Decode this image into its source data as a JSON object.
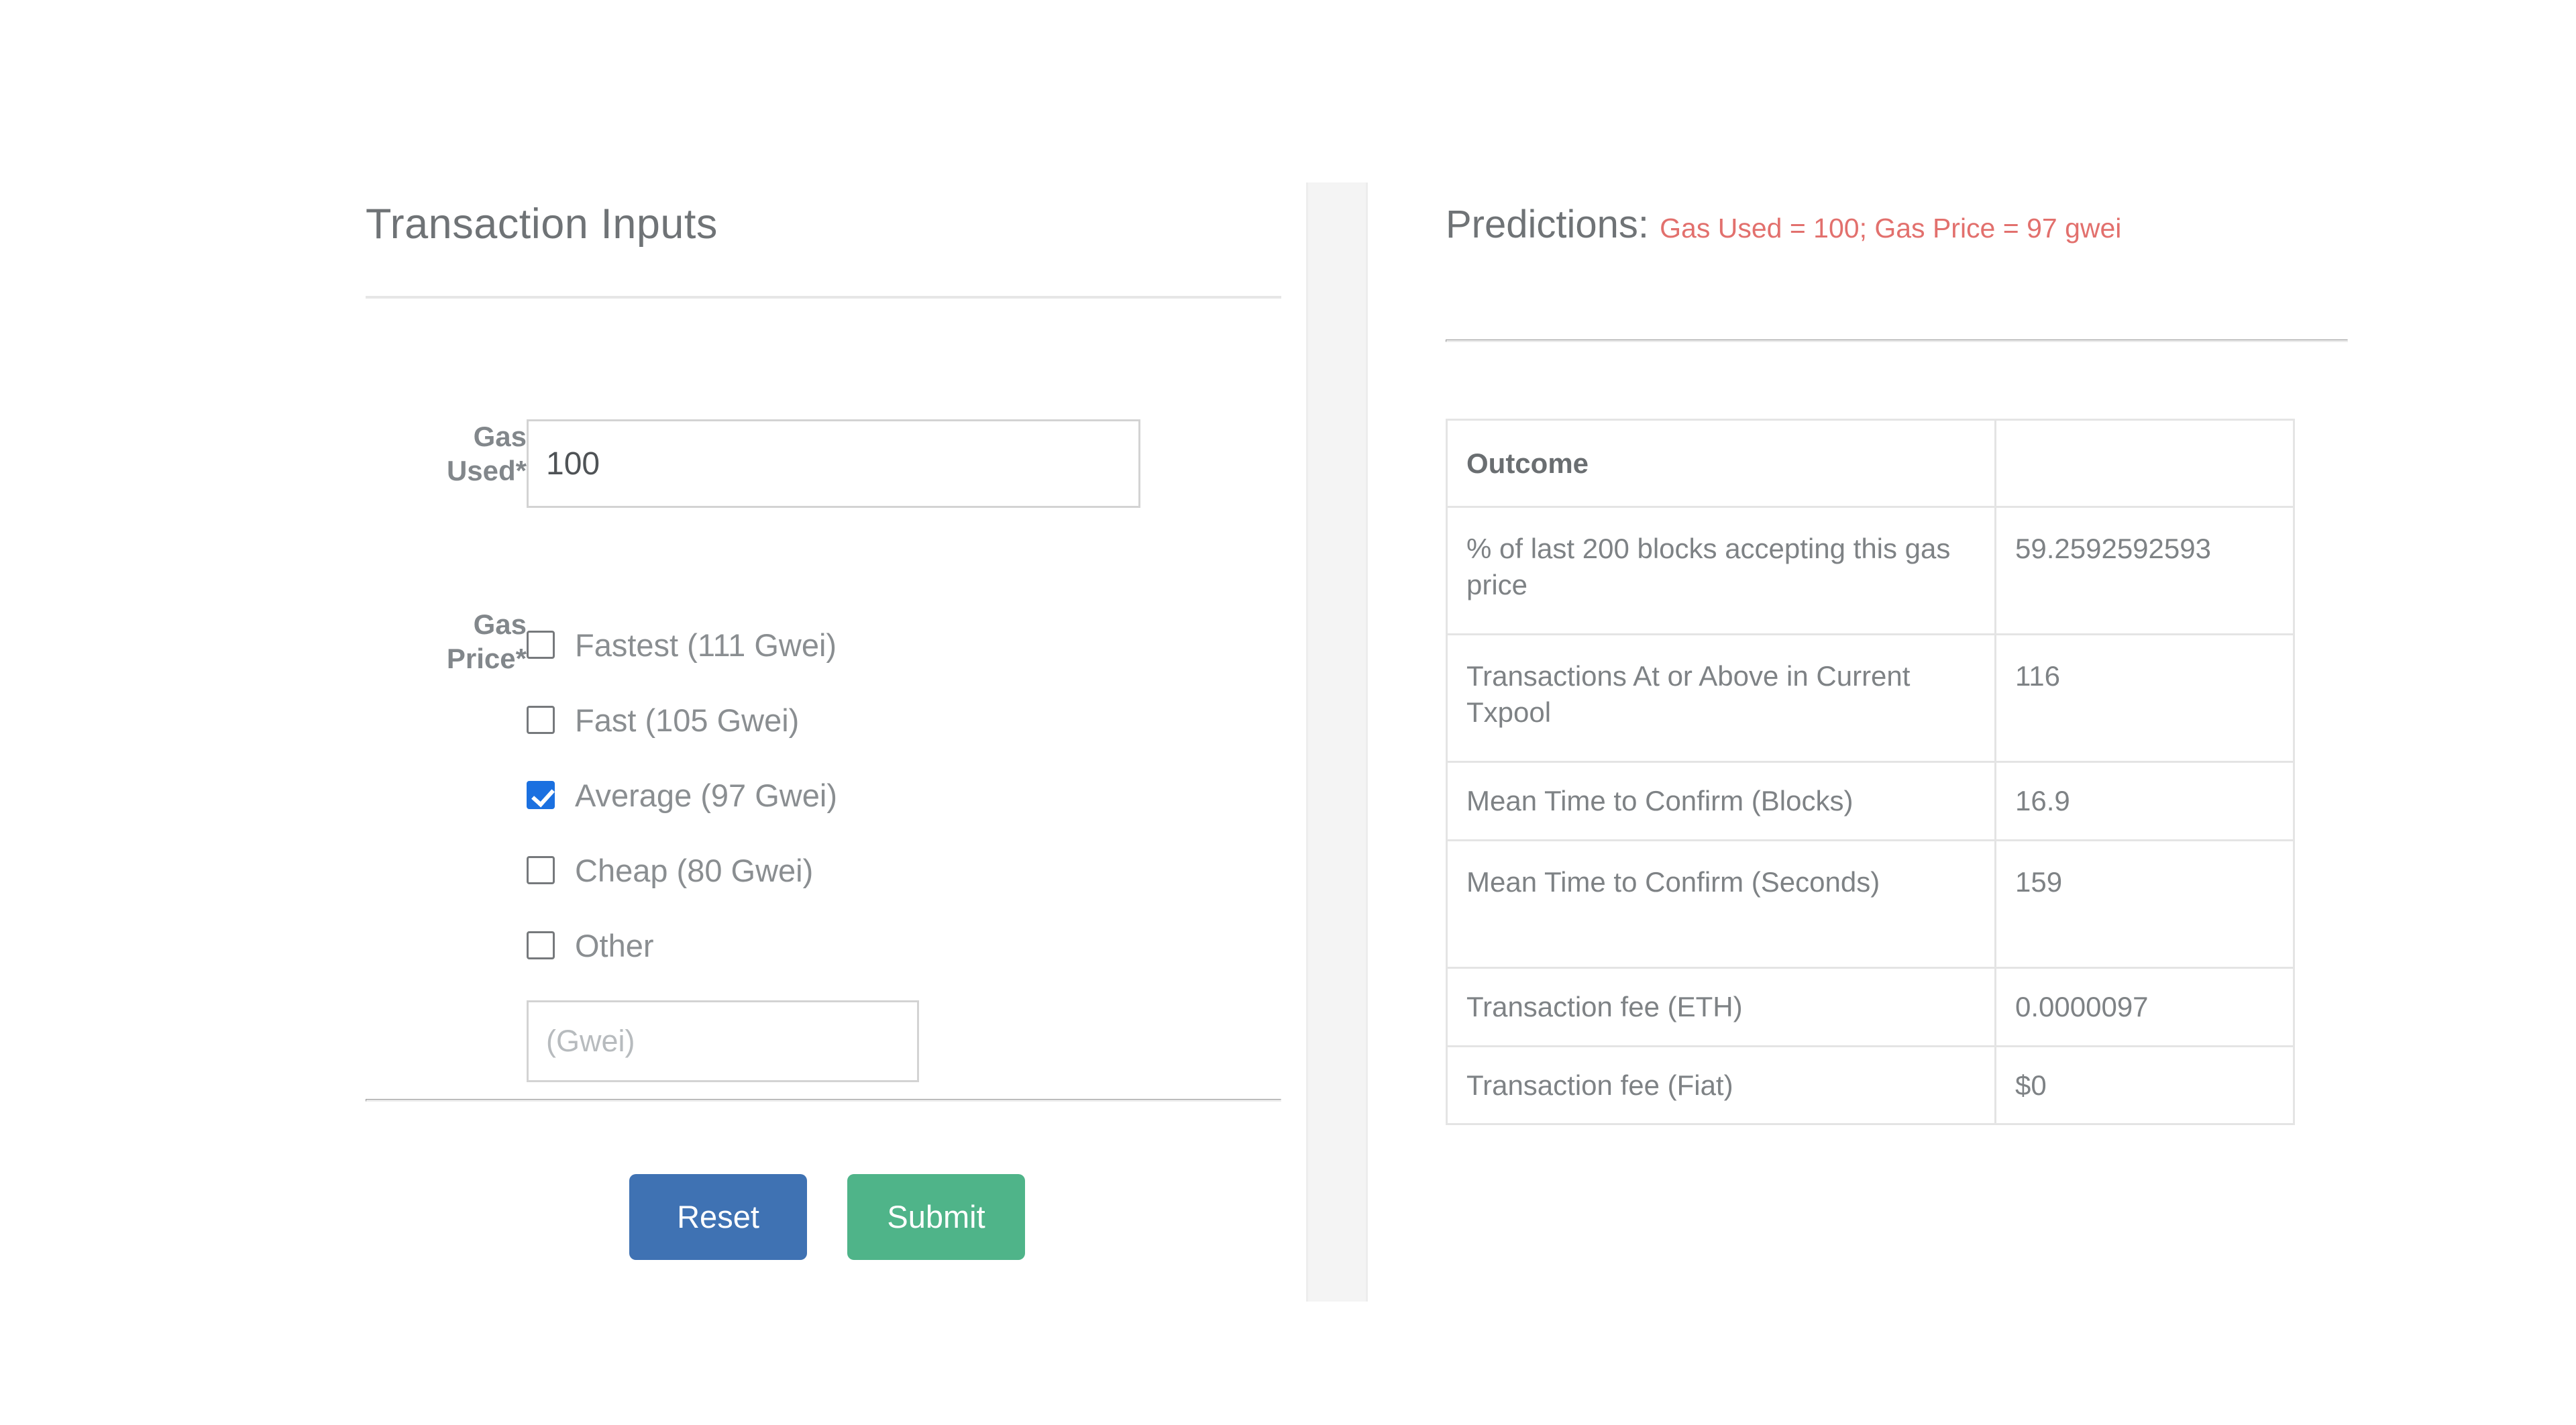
{
  "left_panel": {
    "title": "Transaction Inputs",
    "gas_used": {
      "label_line1": "Gas",
      "label_line2": "Used*",
      "value": "100",
      "placeholder": ""
    },
    "gas_price": {
      "label_line1": "Gas",
      "label_line2": "Price*",
      "options": [
        {
          "label": "Fastest (111 Gwei)",
          "checked": false
        },
        {
          "label": "Fast (105 Gwei)",
          "checked": false
        },
        {
          "label": "Average (97 Gwei)",
          "checked": true
        },
        {
          "label": "Cheap (80 Gwei)",
          "checked": false
        },
        {
          "label": "Other",
          "checked": false
        }
      ],
      "other_input": {
        "value": "",
        "placeholder": "(Gwei)"
      }
    },
    "buttons": {
      "reset_label": "Reset",
      "submit_label": "Submit"
    }
  },
  "right_panel": {
    "heading_main": "Predictions:",
    "heading_sub": "Gas Used = 100; Gas Price = 97 gwei",
    "table": {
      "headers": [
        "Outcome",
        ""
      ],
      "rows": [
        {
          "outcome": "% of last 200 blocks accepting this gas price",
          "value": "59.2592592593"
        },
        {
          "outcome": "Transactions At or Above in Current Txpool",
          "value": "116"
        },
        {
          "outcome": "Mean Time to Confirm (Blocks)",
          "value": "16.9"
        },
        {
          "outcome": "Mean Time to Confirm (Seconds)",
          "value": "159"
        },
        {
          "outcome": "Transaction fee (ETH)",
          "value": "0.0000097"
        },
        {
          "outcome": "Transaction fee (Fiat)",
          "value": "$0"
        }
      ]
    }
  },
  "colors": {
    "reset_button": "#3f72b3",
    "submit_button": "#4fb489",
    "checkbox_checked": "#1b70e0",
    "prediction_sub_text": "#e2706d",
    "heading_text": "#6f7376",
    "body_text": "#7e8285",
    "divider": "#f4f4f4"
  }
}
